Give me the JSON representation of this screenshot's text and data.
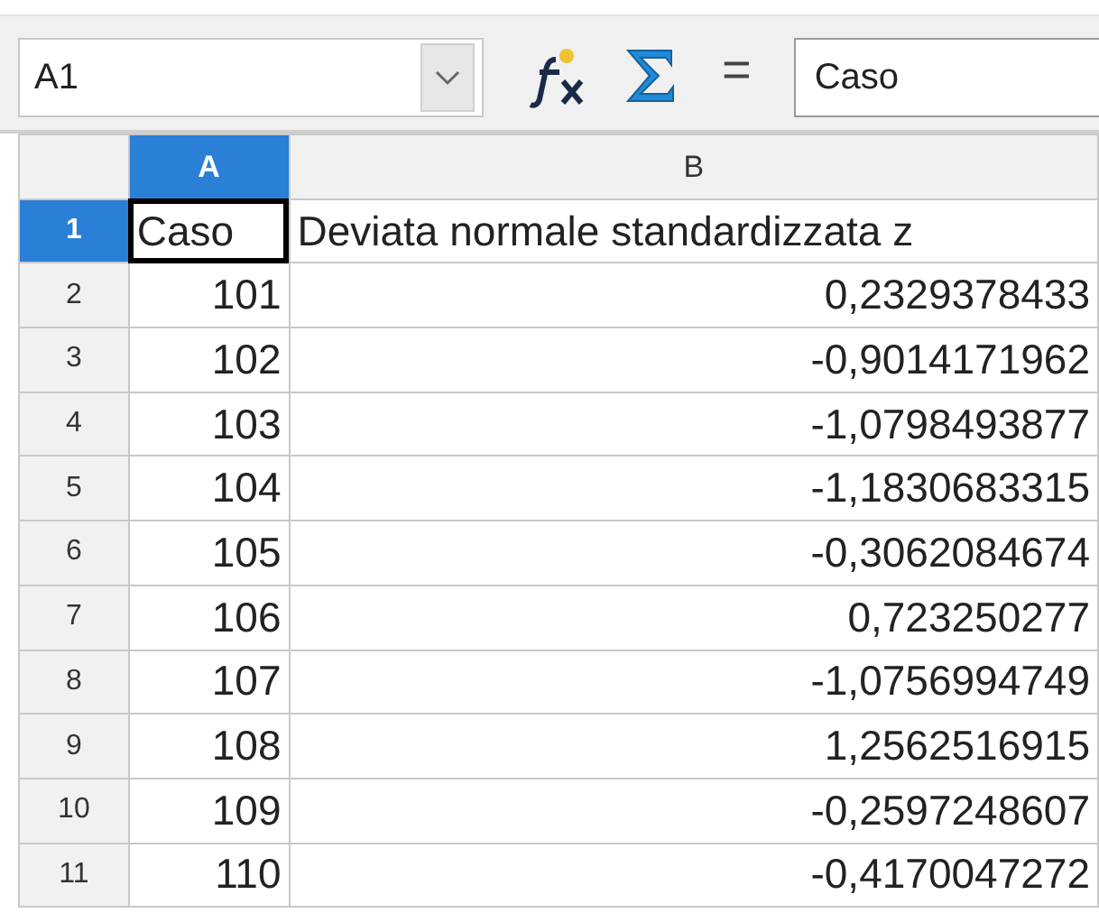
{
  "formula_toolbar": {
    "name_box": "A1",
    "equals_sign": "=",
    "formula_value": "Caso"
  },
  "columns": [
    {
      "label": "A",
      "selected": true
    },
    {
      "label": "B",
      "selected": false
    }
  ],
  "rows": [
    {
      "header": "1",
      "selected": true,
      "cells": [
        {
          "kind": "text",
          "value": "Caso",
          "active": true
        },
        {
          "kind": "text",
          "value": "Deviata normale standardizzata z",
          "active": false
        }
      ]
    },
    {
      "header": "2",
      "selected": false,
      "cells": [
        {
          "kind": "number",
          "value": "101",
          "active": false
        },
        {
          "kind": "number",
          "value": "0,2329378433",
          "active": false
        }
      ]
    },
    {
      "header": "3",
      "selected": false,
      "cells": [
        {
          "kind": "number",
          "value": "102",
          "active": false
        },
        {
          "kind": "number",
          "value": "-0,9014171962",
          "active": false
        }
      ]
    },
    {
      "header": "4",
      "selected": false,
      "cells": [
        {
          "kind": "number",
          "value": "103",
          "active": false
        },
        {
          "kind": "number",
          "value": "-1,0798493877",
          "active": false
        }
      ]
    },
    {
      "header": "5",
      "selected": false,
      "cells": [
        {
          "kind": "number",
          "value": "104",
          "active": false
        },
        {
          "kind": "number",
          "value": "-1,1830683315",
          "active": false
        }
      ]
    },
    {
      "header": "6",
      "selected": false,
      "cells": [
        {
          "kind": "number",
          "value": "105",
          "active": false
        },
        {
          "kind": "number",
          "value": "-0,3062084674",
          "active": false
        }
      ]
    },
    {
      "header": "7",
      "selected": false,
      "cells": [
        {
          "kind": "number",
          "value": "106",
          "active": false
        },
        {
          "kind": "number",
          "value": "0,723250277",
          "active": false
        }
      ]
    },
    {
      "header": "8",
      "selected": false,
      "cells": [
        {
          "kind": "number",
          "value": "107",
          "active": false
        },
        {
          "kind": "number",
          "value": "-1,0756994749",
          "active": false
        }
      ]
    },
    {
      "header": "9",
      "selected": false,
      "cells": [
        {
          "kind": "number",
          "value": "108",
          "active": false
        },
        {
          "kind": "number",
          "value": "1,2562516915",
          "active": false
        }
      ]
    },
    {
      "header": "10",
      "selected": false,
      "cells": [
        {
          "kind": "number",
          "value": "109",
          "active": false
        },
        {
          "kind": "number",
          "value": "-0,2597248607",
          "active": false
        }
      ]
    },
    {
      "header": "11",
      "selected": false,
      "cells": [
        {
          "kind": "number",
          "value": "110",
          "active": false
        },
        {
          "kind": "number",
          "value": "-0,4170047272",
          "active": false
        }
      ]
    }
  ]
}
